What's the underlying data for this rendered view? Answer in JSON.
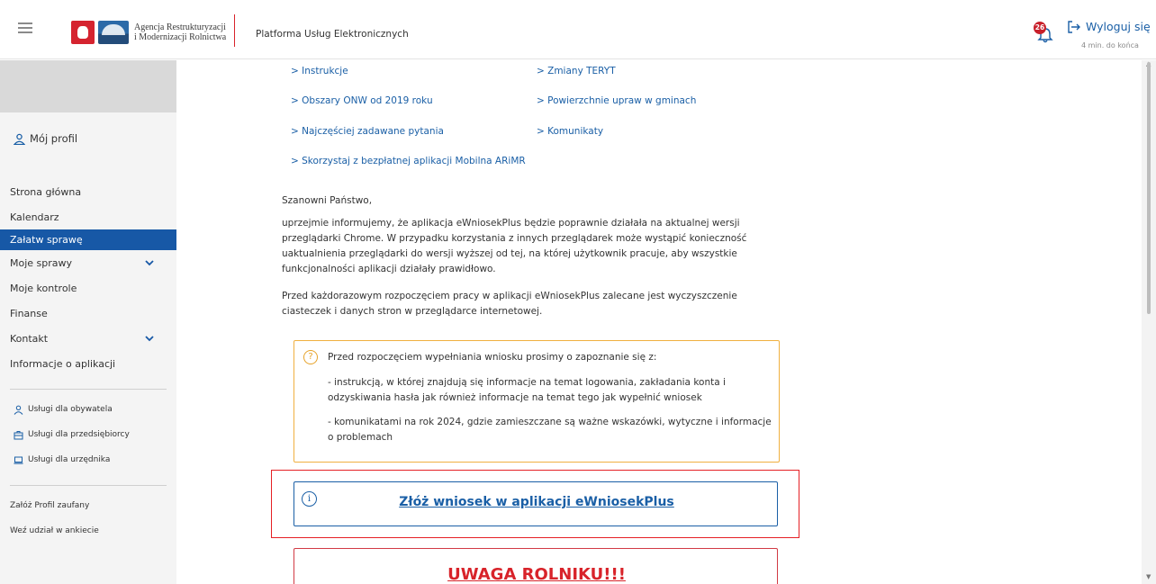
{
  "header": {
    "agency_line1": "Agencja Restrukturyzacji",
    "agency_line2": "i Modernizacji Rolnictwa",
    "platform_title": "Platforma Usług Elektronicznych",
    "notification_count": "26",
    "logout_label": "Wyloguj się",
    "session_timer": "4 min. do końca"
  },
  "sidebar": {
    "profile_label": "Mój profil",
    "nav": [
      {
        "label": "Strona główna"
      },
      {
        "label": "Kalendarz"
      },
      {
        "label": "Załatw sprawę",
        "active": true
      },
      {
        "label": "Moje sprawy",
        "expandable": true
      },
      {
        "label": "Moje kontrole"
      },
      {
        "label": "Finanse"
      },
      {
        "label": "Kontakt",
        "expandable": true
      },
      {
        "label": "Informacje o aplikacji"
      }
    ],
    "services": [
      {
        "label": "Usługi dla obywatela",
        "icon": "person-icon"
      },
      {
        "label": "Usługi dla przedsiębiorcy",
        "icon": "briefcase-icon"
      },
      {
        "label": "Usługi dla urzędnika",
        "icon": "laptop-icon"
      }
    ],
    "links": [
      {
        "label": "Załóż Profil zaufany"
      },
      {
        "label": "Weź udział w ankiecie"
      }
    ]
  },
  "main": {
    "quick_links": [
      "> Instrukcje",
      "> Zmiany TERYT",
      "> Obszary ONW od 2019 roku",
      "> Powierzchnie upraw w gminach",
      "> Najczęściej zadawane pytania",
      "> Komunikaty",
      "> Skorzystaj z bezpłatnej aplikacji Mobilna ARiMR"
    ],
    "greeting": "Szanowni Państwo,",
    "para1": "uprzejmie informujemy, że aplikacja eWniosekPlus będzie poprawnie działała na aktualnej wersji przeglądarki Chrome. W przypadku korzystania z innych przeglądarek może wystąpić konieczność uaktualnienia przeglądarki do wersji wyższej od tej, na której użytkownik pracuje, aby wszystkie funkcjonalności aplikacji działały prawidłowo.",
    "para2": "Przed każdorazowym rozpoczęciem pracy w aplikacji eWniosekPlus zalecane jest wyczyszczenie ciasteczek i danych stron w przeglądarce internetowej.",
    "info_box": {
      "heading": "Przed rozpoczęciem wypełniania wniosku prosimy o zapoznanie się z:",
      "item1": "- instrukcją, w której znajdują się informacje na temat logowania, zakładania konta i odzyskiwania hasła jak również informacje na temat tego jak wypełnić wniosek",
      "item2": "- komunikatami na rok 2024, gdzie zamieszczane są ważne wskazówki, wytyczne i informacje o problemach"
    },
    "cta_label": "Złóż wniosek w aplikacji eWniosekPlus",
    "warning_label": "UWAGA ROLNIKU!!!"
  },
  "colors": {
    "brand_blue": "#1758a6",
    "link_blue": "#1a5fa6",
    "highlight_red": "#e52025",
    "info_orange": "#f0b040"
  }
}
